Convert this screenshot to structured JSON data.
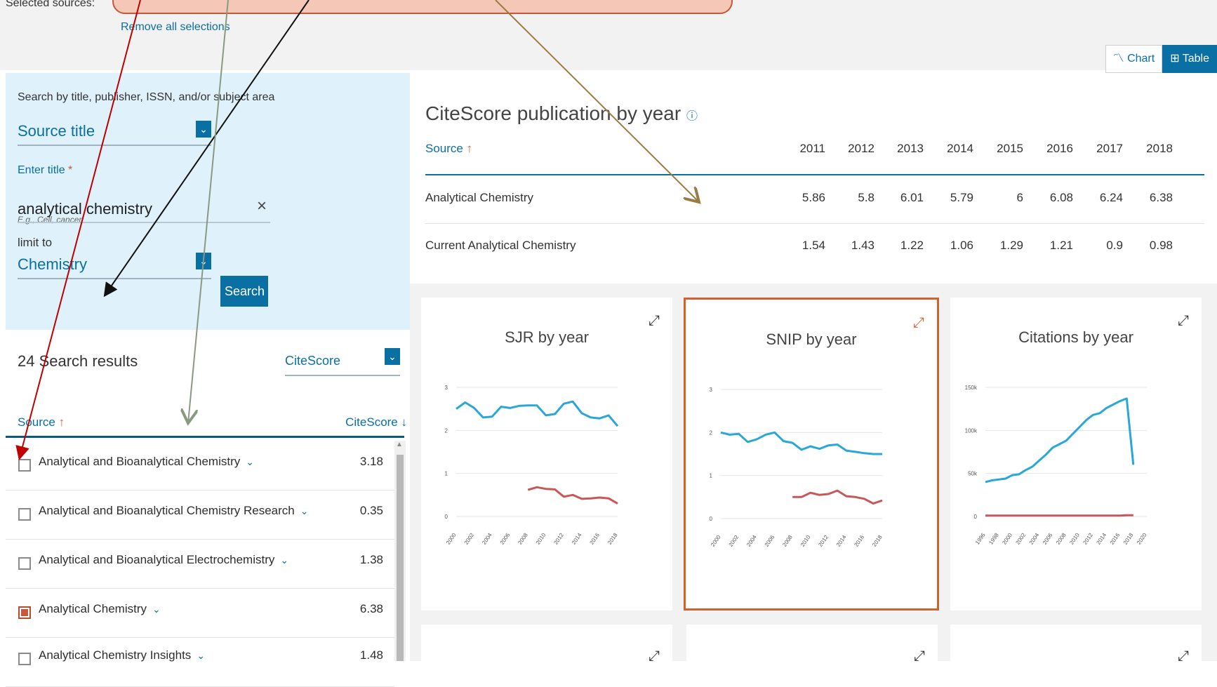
{
  "top": {
    "selected_sources_label": "Selected sources:",
    "remove_all": "Remove all selections",
    "view_chart": "Chart",
    "view_table": "Table"
  },
  "search": {
    "hint": "Search by title, publisher, ISSN, and/or subject area",
    "field_type": "Source title",
    "title_label": "Enter title",
    "required_mark": "*",
    "title_value": "analytical chemistry",
    "example": "E.g., Cell, cancer",
    "limit_label": "limit to",
    "limit_value": "Chemistry",
    "search_button": "Search",
    "clear": "×"
  },
  "results": {
    "count": "24 Search results",
    "sort_by": "CiteScore",
    "col_source": "Source",
    "col_source_arrow": "↑",
    "col_citescore": "CiteScore",
    "col_citescore_arrow": "↓",
    "rows": [
      {
        "name": "Analytical and Bioanalytical Chemistry",
        "value": "3.18",
        "checked": false
      },
      {
        "name": "Analytical and Bioanalytical Chemistry Research",
        "value": "0.35",
        "checked": false
      },
      {
        "name": "Analytical and Bioanalytical Electrochemistry",
        "value": "1.38",
        "checked": false
      },
      {
        "name": "Analytical Chemistry",
        "value": "6.38",
        "checked": true
      },
      {
        "name": "Analytical Chemistry Insights",
        "value": "1.48",
        "checked": false
      }
    ]
  },
  "table": {
    "title": "CiteScore publication by year",
    "source_header": "Source",
    "source_arrow": "↑",
    "years": [
      "2011",
      "2012",
      "2013",
      "2014",
      "2015",
      "2016",
      "2017",
      "2018"
    ],
    "rows": [
      {
        "name": "Analytical Chemistry",
        "values": [
          "5.86",
          "5.8",
          "6.01",
          "5.79",
          "6",
          "6.08",
          "6.24",
          "6.38"
        ]
      },
      {
        "name": "Current Analytical Chemistry",
        "values": [
          "1.54",
          "1.43",
          "1.22",
          "1.06",
          "1.29",
          "1.21",
          "0.9",
          "0.98"
        ]
      }
    ]
  },
  "colors": {
    "accent": "#0a6fa3",
    "series_a": "#2aa7d6",
    "series_b": "#c8575a",
    "highlight": "#d0622e"
  },
  "chart_data": [
    {
      "type": "line",
      "title": "SJR by year",
      "x": [
        2000,
        2001,
        2002,
        2003,
        2004,
        2005,
        2006,
        2007,
        2008,
        2009,
        2010,
        2011,
        2012,
        2013,
        2014,
        2015,
        2016,
        2017
      ],
      "xticks": [
        "2000",
        "2002",
        "2004",
        "2006",
        "2008",
        "2010",
        "2012",
        "2014",
        "2016",
        "2018"
      ],
      "yticks": [
        "0",
        "1",
        "2",
        "3"
      ],
      "ylim": [
        0,
        3
      ],
      "series": [
        {
          "values": [
            2.5,
            2.65,
            2.52,
            2.3,
            2.32,
            2.55,
            2.52,
            2.57,
            2.58,
            2.58,
            2.35,
            2.38,
            2.62,
            2.67,
            2.4,
            2.3,
            2.28,
            2.35,
            2.1
          ]
        },
        {
          "values": [
            null,
            null,
            null,
            null,
            null,
            null,
            null,
            null,
            0.62,
            0.68,
            0.64,
            0.63,
            0.46,
            0.5,
            0.41,
            0.42,
            0.44,
            0.42,
            0.3
          ]
        }
      ]
    },
    {
      "type": "line",
      "title": "SNIP by year",
      "x": [
        2000,
        2001,
        2002,
        2003,
        2004,
        2005,
        2006,
        2007,
        2008,
        2009,
        2010,
        2011,
        2012,
        2013,
        2014,
        2015,
        2016,
        2017,
        2018
      ],
      "xticks": [
        "2000",
        "2002",
        "2004",
        "2006",
        "2008",
        "2010",
        "2012",
        "2014",
        "2016",
        "2018"
      ],
      "yticks": [
        "0",
        "1",
        "2",
        "3"
      ],
      "ylim": [
        0,
        3
      ],
      "series": [
        {
          "values": [
            2.0,
            1.95,
            1.97,
            1.78,
            1.84,
            1.95,
            2.0,
            1.8,
            1.76,
            1.6,
            1.68,
            1.62,
            1.7,
            1.72,
            1.58,
            1.55,
            1.52,
            1.5,
            1.5
          ]
        },
        {
          "values": [
            null,
            null,
            null,
            null,
            null,
            null,
            null,
            null,
            0.5,
            0.5,
            0.6,
            0.55,
            0.57,
            0.65,
            0.52,
            0.5,
            0.46,
            0.35,
            0.42
          ]
        }
      ]
    },
    {
      "type": "line",
      "title": "Citations by year",
      "x": [
        1996,
        1997,
        1998,
        1999,
        2000,
        2001,
        2002,
        2003,
        2004,
        2005,
        2006,
        2007,
        2008,
        2009,
        2010,
        2011,
        2012,
        2013,
        2014,
        2015,
        2016,
        2017,
        2018,
        2019
      ],
      "xticks": [
        "1996",
        "1998",
        "2000",
        "2002",
        "2004",
        "2006",
        "2008",
        "2010",
        "2012",
        "2014",
        "2016",
        "2018",
        "2020"
      ],
      "yticks": [
        "0",
        "50k",
        "100k",
        "150k"
      ],
      "ylim": [
        0,
        150000
      ],
      "series": [
        {
          "values": [
            40000,
            42000,
            43000,
            44000,
            48000,
            49000,
            54000,
            58000,
            65000,
            72000,
            80000,
            84000,
            88000,
            96000,
            104000,
            112000,
            118000,
            120000,
            126000,
            130000,
            134000,
            137000,
            60000
          ]
        },
        {
          "values": [
            1000,
            1000,
            1000,
            1000,
            1000,
            1000,
            1000,
            1000,
            1000,
            1000,
            1000,
            1000,
            1000,
            1000,
            1000,
            1000,
            1000,
            1000,
            1000,
            1000,
            1000,
            1500,
            1500
          ]
        }
      ]
    }
  ],
  "bottom_cards": [
    "",
    "",
    ""
  ]
}
